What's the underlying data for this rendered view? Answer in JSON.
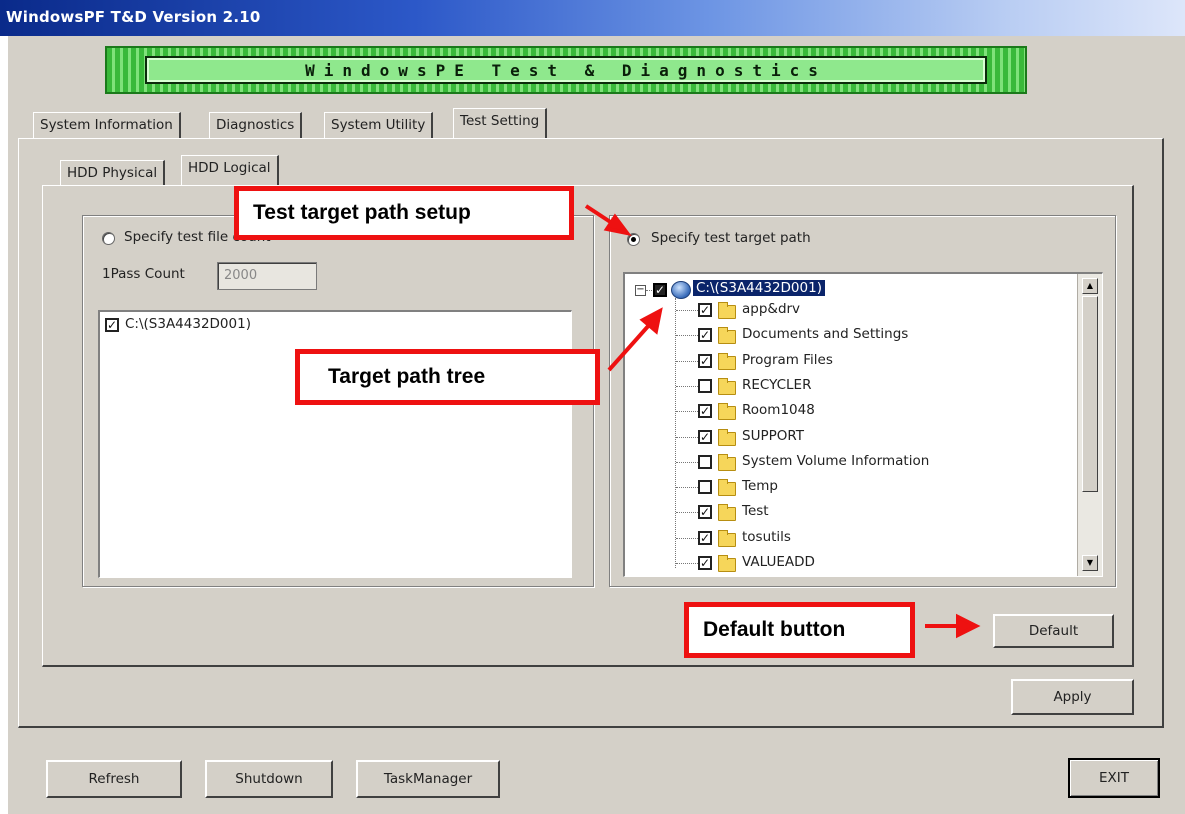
{
  "window": {
    "title": "WindowsPF T&D Version 2.10"
  },
  "banner": {
    "text": "WindowsPE Test & Diagnostics"
  },
  "main_tabs": [
    {
      "label": "System Information"
    },
    {
      "label": "Diagnostics"
    },
    {
      "label": "System Utility"
    },
    {
      "label": "Test Setting"
    }
  ],
  "sub_tabs": [
    {
      "label": "HDD Physical"
    },
    {
      "label": "HDD Logical"
    }
  ],
  "file_count_panel": {
    "radio_label": "Specify test file count",
    "pass_count_label": "1Pass Count",
    "pass_count_value": "2000",
    "drive_item": "C:\\(S3A4432D001)"
  },
  "target_path_panel": {
    "radio_label": "Specify test target path",
    "root": "C:\\(S3A4432D001)",
    "folders": [
      {
        "name": "app&drv",
        "checked": true
      },
      {
        "name": "Documents and Settings",
        "checked": true
      },
      {
        "name": "Program Files",
        "checked": true
      },
      {
        "name": "RECYCLER",
        "checked": false
      },
      {
        "name": "Room1048",
        "checked": true
      },
      {
        "name": "SUPPORT",
        "checked": true
      },
      {
        "name": "System Volume Information",
        "checked": false
      },
      {
        "name": "Temp",
        "checked": false
      },
      {
        "name": "Test",
        "checked": true
      },
      {
        "name": "tosutils",
        "checked": true
      },
      {
        "name": "VALUEADD",
        "checked": true
      }
    ]
  },
  "buttons": {
    "default": "Default",
    "apply": "Apply",
    "refresh": "Refresh",
    "shutdown": "Shutdown",
    "taskmanager": "TaskManager",
    "exit": "EXIT"
  },
  "callouts": {
    "target_path_setup": "Test target path setup",
    "target_path_tree": "Target path tree",
    "default_button": "Default button"
  },
  "colors": {
    "callout_border": "#ee1111",
    "banner_green": "#39b93a"
  }
}
